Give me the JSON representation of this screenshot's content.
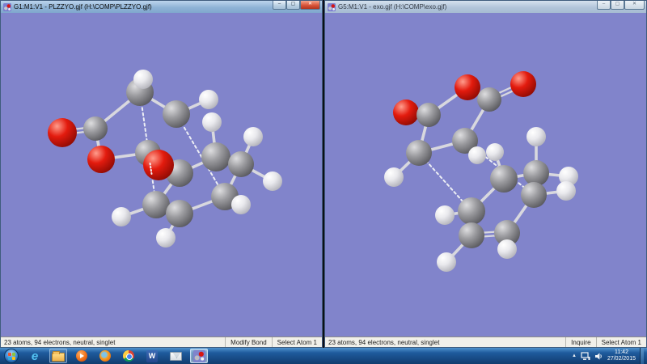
{
  "windows": [
    {
      "title": "G1:M1:V1 - PLZZYO.gjf (H:\\COMP\\PLZZYO.gjf)",
      "active": true,
      "controls": {
        "minimize": "–",
        "maximize": "▢",
        "close": "✕"
      },
      "status_left": "23 atoms, 94 electrons, neutral, singlet",
      "status_mode": "Modify Bond",
      "status_selection": "Select Atom 1",
      "molecule": {
        "atoms": [
          [
            "O",
            76,
            148,
            18
          ],
          [
            "C",
            117,
            143,
            15
          ],
          [
            "O",
            124,
            181,
            17
          ],
          [
            "C",
            172,
            98,
            17
          ],
          [
            "H",
            176,
            82,
            12
          ],
          [
            "C",
            217,
            125,
            17
          ],
          [
            "H",
            257,
            107,
            12
          ],
          [
            "H",
            261,
            135,
            12
          ],
          [
            "C",
            182,
            173,
            16
          ],
          [
            "C",
            221,
            198,
            17
          ],
          [
            "O",
            195,
            188,
            19
          ],
          [
            "C",
            266,
            178,
            18
          ],
          [
            "C",
            297,
            187,
            16
          ],
          [
            "H",
            312,
            153,
            12
          ],
          [
            "H",
            336,
            208,
            12
          ],
          [
            "C",
            192,
            237,
            17
          ],
          [
            "C",
            221,
            248,
            17
          ],
          [
            "C",
            277,
            227,
            17
          ],
          [
            "H",
            149,
            252,
            12
          ],
          [
            "H",
            204,
            278,
            12
          ],
          [
            "H",
            297,
            237,
            12
          ]
        ],
        "bonds": [
          [
            0,
            1,
            "d"
          ],
          [
            1,
            2,
            "s"
          ],
          [
            2,
            8,
            "s"
          ],
          [
            1,
            3,
            "s"
          ],
          [
            3,
            4,
            "s"
          ],
          [
            3,
            5,
            "s"
          ],
          [
            5,
            6,
            "s"
          ],
          [
            11,
            7,
            "s"
          ],
          [
            8,
            9,
            "s"
          ],
          [
            9,
            11,
            "s"
          ],
          [
            11,
            12,
            "s"
          ],
          [
            12,
            13,
            "s"
          ],
          [
            12,
            14,
            "s"
          ],
          [
            9,
            15,
            "s"
          ],
          [
            15,
            16,
            "d"
          ],
          [
            16,
            17,
            "s"
          ],
          [
            17,
            12,
            "s"
          ],
          [
            15,
            18,
            "s"
          ],
          [
            16,
            19,
            "s"
          ],
          [
            17,
            20,
            "s"
          ]
        ],
        "dashed": [
          [
            3,
            15
          ],
          [
            5,
            17
          ]
        ],
        "overlay": [
          [
            184.5,
            186,
            186.5,
            199
          ]
        ]
      }
    },
    {
      "title": "G5:M1:V1 - exo.gjf (H:\\COMP\\exo.gjf)",
      "active": false,
      "controls": {
        "minimize": "–",
        "maximize": "▢",
        "close": "✕"
      },
      "status_left": "23 atoms, 94 electrons, neutral, singlet",
      "status_mode": "Inquire",
      "status_selection": "Select Atom 1",
      "molecule": {
        "atoms": [
          [
            "O",
            100,
            123,
            16
          ],
          [
            "C",
            128,
            126,
            15
          ],
          [
            "O",
            176,
            92,
            16
          ],
          [
            "C",
            203,
            107,
            15
          ],
          [
            "O",
            245,
            88,
            16
          ],
          [
            "C",
            173,
            158,
            16
          ],
          [
            "C",
            116,
            173,
            16
          ],
          [
            "H",
            85,
            203,
            12
          ],
          [
            "H",
            188,
            176,
            11
          ],
          [
            "H",
            210,
            172,
            11
          ],
          [
            "C",
            261,
            198,
            16
          ],
          [
            "H",
            261,
            153,
            12
          ],
          [
            "C",
            221,
            205,
            17
          ],
          [
            "H",
            301,
            202,
            12
          ],
          [
            "C",
            258,
            225,
            16
          ],
          [
            "H",
            298,
            220,
            12
          ],
          [
            "C",
            181,
            245,
            17
          ],
          [
            "H",
            148,
            250,
            12
          ],
          [
            "C",
            181,
            275,
            16
          ],
          [
            "C",
            225,
            272,
            16
          ],
          [
            "H",
            225,
            292,
            12
          ],
          [
            "H",
            150,
            308,
            12
          ]
        ],
        "bonds": [
          [
            0,
            1,
            "d"
          ],
          [
            1,
            2,
            "s"
          ],
          [
            2,
            3,
            "s"
          ],
          [
            3,
            4,
            "d"
          ],
          [
            1,
            6,
            "s"
          ],
          [
            3,
            5,
            "s"
          ],
          [
            5,
            6,
            "s"
          ],
          [
            5,
            8,
            "s"
          ],
          [
            12,
            9,
            "s"
          ],
          [
            6,
            7,
            "s"
          ],
          [
            12,
            10,
            "s"
          ],
          [
            10,
            11,
            "s"
          ],
          [
            10,
            13,
            "s"
          ],
          [
            10,
            14,
            "s"
          ],
          [
            14,
            15,
            "s"
          ],
          [
            14,
            19,
            "s"
          ],
          [
            12,
            16,
            "s"
          ],
          [
            16,
            18,
            "s"
          ],
          [
            18,
            19,
            "d"
          ],
          [
            16,
            17,
            "s"
          ],
          [
            19,
            20,
            "s"
          ],
          [
            18,
            21,
            "s"
          ]
        ],
        "dashed": [
          [
            6,
            16
          ],
          [
            5,
            14
          ]
        ],
        "overlay": []
      }
    }
  ],
  "taskbar": {
    "start_label": "Start",
    "icons": [
      "internet-explorer",
      "windows-explorer",
      "media-player",
      "firefox",
      "chrome",
      "word",
      "mail",
      "gaussview"
    ],
    "clock": {
      "time": "11:42",
      "date": "27/02/2015"
    }
  },
  "colors": {
    "viewport_background": "#8184cb",
    "carbon": "#8a8a8e",
    "oxygen": "#dd1111",
    "hydrogen": "#f0f0f0",
    "bond": "#d8d8de",
    "active_titlebar": "#8fb3d6",
    "taskbar_blue": "#1e5a9c",
    "status_bar": "#f1f0ea"
  }
}
